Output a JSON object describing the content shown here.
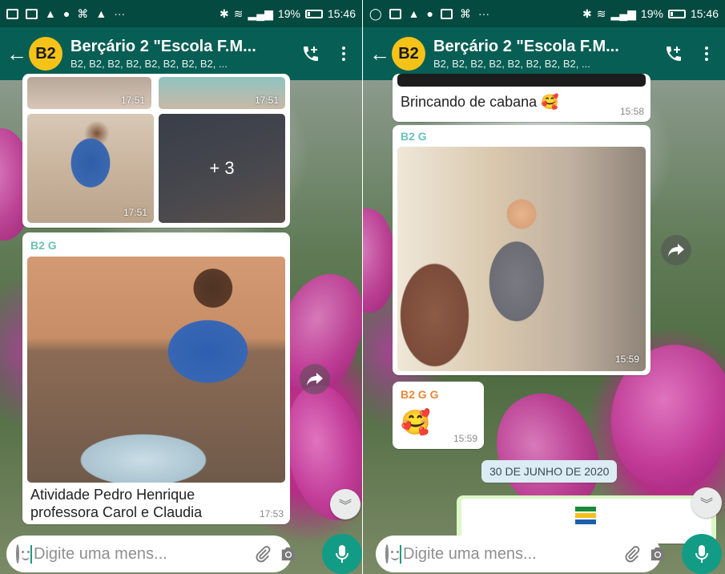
{
  "statusbar": {
    "left": {
      "battery": "19%",
      "time": "15:46"
    },
    "right": {
      "battery": "19%",
      "time": "15:46"
    }
  },
  "appbar": {
    "title": "Berçário 2 \"Escola F.M...",
    "subtitle": "B2, B2, B2, B2, B2, B2, B2, B2, ...",
    "avatar_text": "B2"
  },
  "left": {
    "grid_times": [
      "17:51",
      "17:51",
      "17:51"
    ],
    "more_count": "+ 3",
    "msg2": {
      "sender": "B2 G",
      "caption": "Atividade Pedro Henrique professora Carol e Claudia",
      "time": "17:53"
    }
  },
  "right": {
    "msg1": {
      "caption": "Brincando de cabana 🥰",
      "time": "15:58"
    },
    "msg2": {
      "sender": "B2 G",
      "time": "15:59"
    },
    "msg3": {
      "sender": "B2 G G",
      "emoji": "🥰",
      "time": "15:59"
    },
    "date_chip": "30 DE JUNHO DE 2020"
  },
  "input": {
    "placeholder": "Digite uma mens..."
  },
  "colors": {
    "statusbar": "#044a40",
    "appbar": "#075e54",
    "accent": "#129c86",
    "avatar": "#f5c318",
    "sender_teal": "#6cc1b6",
    "sender_orange": "#e8873a"
  },
  "icons": [
    "back-arrow-icon",
    "add-call-icon",
    "more-vert-icon",
    "forward-icon",
    "chevron-double-down-icon",
    "emoji-icon",
    "paperclip-icon",
    "camera-icon",
    "mic-icon"
  ]
}
